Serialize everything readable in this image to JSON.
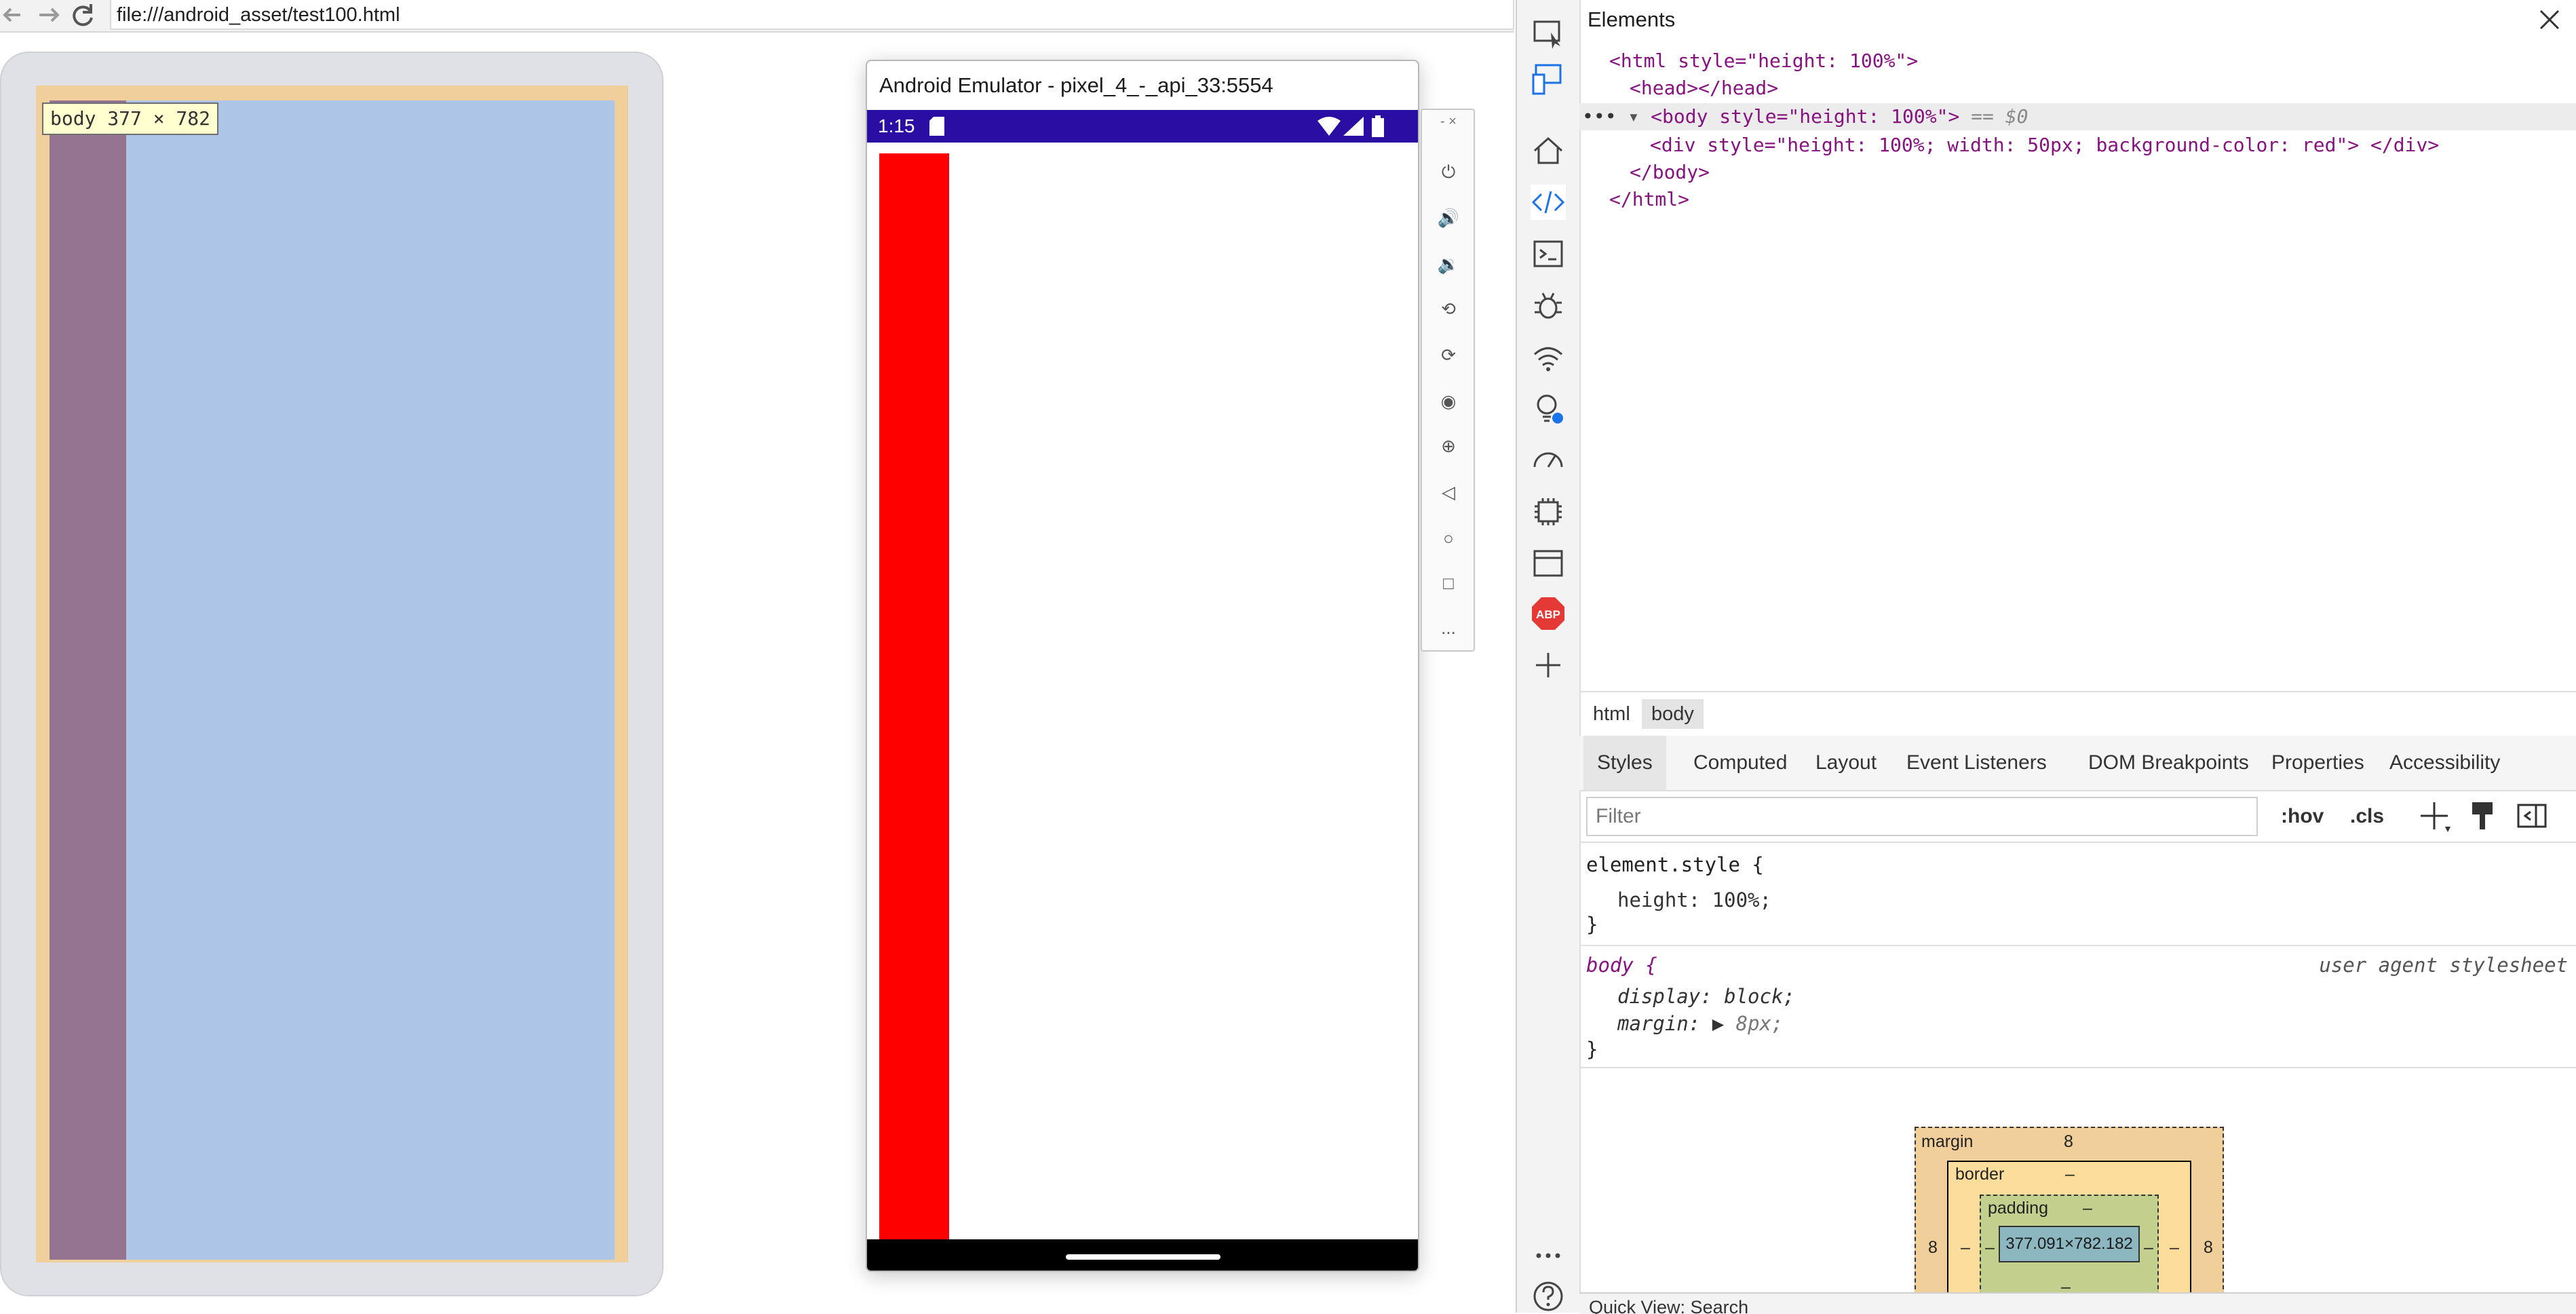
{
  "browser": {
    "url": "file:///android_asset/test100.html",
    "tooltip": "body 377 × 782"
  },
  "emulator": {
    "title": "Android Emulator - pixel_4_-_api_33:5554",
    "time": "1:15",
    "side_more": "..."
  },
  "devtools": {
    "panel_title": "Elements",
    "dom": {
      "line1": "<html style=\"height: 100%\">",
      "line2": "<head></head>",
      "line3": "<body style=\"height: 100%\">",
      "line3_suffix": "== $0",
      "line4": "<div style=\"height: 100%; width: 50px; background-color: red\"> </div>",
      "line5": "</body>",
      "line6": "</html>"
    },
    "breadcrumbs": [
      "html",
      "body"
    ],
    "tabs": [
      "Styles",
      "Computed",
      "Layout",
      "Event Listeners",
      "DOM Breakpoints",
      "Properties",
      "Accessibility"
    ],
    "filter_placeholder": "Filter",
    "tools": {
      "hov": ":hov",
      "cls": ".cls"
    },
    "styles": {
      "element_style": "element.style {",
      "element_prop": "height: 100%;",
      "close": "}",
      "body_selector": "body {",
      "ua_label": "user agent stylesheet",
      "body_prop1": "display: block;",
      "body_prop2": "margin:",
      "body_prop2_value": "8px;"
    },
    "box_model": {
      "margin_label": "margin",
      "margin_value": "8",
      "margin_left": "8",
      "margin_right": "8",
      "border_label": "border",
      "border_value": "–",
      "padding_label": "padding",
      "padding_value": "–",
      "dash": "–",
      "content": "377.091×782.182"
    },
    "quick_view": "Quick View:  Search"
  },
  "colors": {
    "emulator_status": "#2a0ea4",
    "red_div": "#ff0000",
    "margin_overlay": "#f0cf9b",
    "content_overlay": "#adc5e6",
    "div_overlay": "#947490"
  }
}
